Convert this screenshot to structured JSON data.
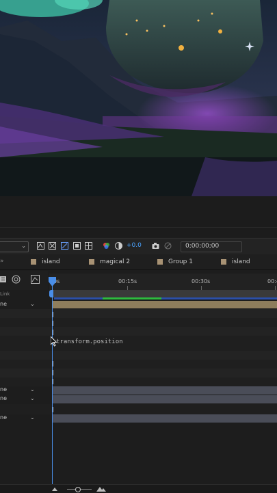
{
  "toolbar": {
    "exposure_value": "+0.0",
    "timecode": "0;00;00;00"
  },
  "tabs": [
    {
      "label": "island"
    },
    {
      "label": "magical 2"
    },
    {
      "label": "Group 1"
    },
    {
      "label": "island"
    }
  ],
  "ruler": {
    "ticks": [
      "0s",
      "00:15s",
      "00:30s",
      "00:4"
    ]
  },
  "layers": {
    "column_header": "Link",
    "mode_rows": [
      {
        "label": "ne"
      },
      {
        "label": "ne"
      },
      {
        "label": "ne"
      },
      {
        "label": "ne"
      }
    ],
    "expression": "transform.position"
  },
  "colors": {
    "label_swatch": "#a89274",
    "accent_blue": "#4a8ee8",
    "work_green": "#2dbb3e",
    "track_tan": "#8e7d5c",
    "track_slate": "#4a4d58"
  }
}
